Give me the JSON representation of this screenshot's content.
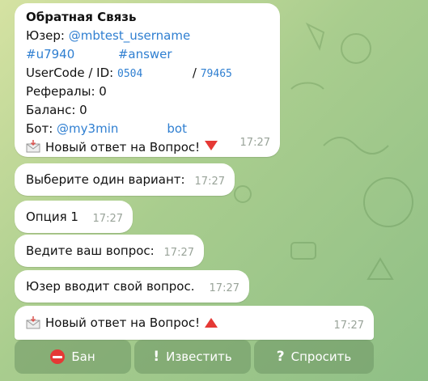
{
  "colors": {
    "link": "#2f7fd1",
    "bubble": "#ffffff",
    "accent_red": "#e53935",
    "keyboard_button": "#7fa674"
  },
  "messages": [
    {
      "title": "Обратная Связь",
      "user_label": "Юзер:",
      "user_link": "@mbtest_username",
      "tag1": "#u7940",
      "tag2": "#answer",
      "usercode_label": "UserCode / ID:",
      "usercode_value": "0504",
      "slash": "/",
      "id_value": "79465",
      "referrals": "Рефералы: 0",
      "balance": "Баланс: 0",
      "bot_label": "Бот:",
      "bot_link_start": "@my3min",
      "bot_link_end": "bot",
      "new_answer_text": "Новый ответ на Вопрос!",
      "time": "17:27"
    },
    {
      "text": "Выберите один вариант:",
      "time": "17:27"
    },
    {
      "text": "Опция 1",
      "time": "17:27"
    },
    {
      "text": "Ведите ваш вопрос:",
      "time": "17:27"
    },
    {
      "text": "Юзер вводит свой вопрос.",
      "time": "17:27"
    },
    {
      "text": "Новый ответ на Вопрос!",
      "time": "17:27"
    }
  ],
  "keyboard": {
    "ban_label": "Бан",
    "notify_glyph": "!",
    "notify_label": "Известить",
    "ask_glyph": "?",
    "ask_label": "Спросить"
  },
  "icons": [
    "envelope-arrow-icon",
    "red-triangle-down-icon",
    "red-triangle-up-icon",
    "no-entry-icon"
  ]
}
